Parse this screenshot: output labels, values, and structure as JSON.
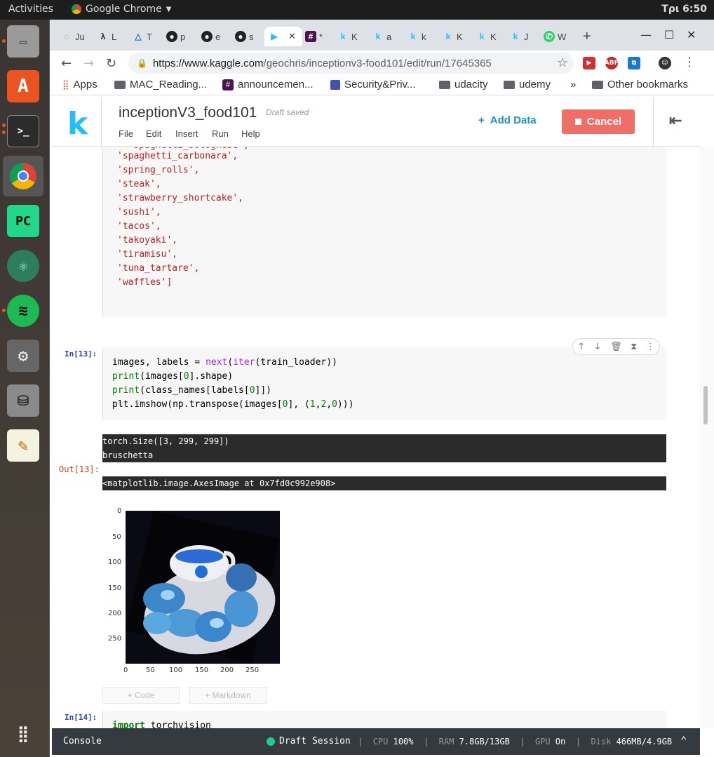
{
  "os": {
    "activities": "Activities",
    "app_name": "Google Chrome",
    "clock": "Τρι 6:50"
  },
  "tabs": [
    {
      "label": "Ju",
      "icon": "jupyter-icon"
    },
    {
      "label": "L",
      "icon": "lambda-icon"
    },
    {
      "label": "T",
      "icon": "triangle-icon"
    },
    {
      "label": "p",
      "icon": "github-icon"
    },
    {
      "label": "e",
      "icon": "github-icon"
    },
    {
      "label": "s",
      "icon": "github-icon"
    },
    {
      "label": "",
      "icon": "play-icon",
      "active": true
    },
    {
      "label": "*",
      "icon": "slack-icon"
    },
    {
      "label": "K",
      "icon": "kaggle-icon"
    },
    {
      "label": "a",
      "icon": "kaggle-icon"
    },
    {
      "label": "k",
      "icon": "kaggle-icon"
    },
    {
      "label": "K",
      "icon": "kaggle-icon"
    },
    {
      "label": "K",
      "icon": "kaggle-icon"
    },
    {
      "label": "J",
      "icon": "kaggle-icon"
    },
    {
      "label": "W",
      "icon": "whatsapp-icon"
    }
  ],
  "address": {
    "host": "https://www.kaggle.com",
    "path": "/geochris/inceptionv3-food101/edit/run/17645365"
  },
  "bookmarks": {
    "apps": "Apps",
    "b1": "MAC_Reading...",
    "b2": "announcemen...",
    "b3": "Security&Priv...",
    "b4": "udacity",
    "b5": "udemy",
    "more": "»",
    "other": "Other bookmarks"
  },
  "kaggle": {
    "logo": "k",
    "title": "inceptionV3_food101",
    "draft": "Draft saved",
    "menu": [
      "File",
      "Edit",
      "Insert",
      "Run",
      "Help"
    ],
    "add_data": "Add Data",
    "cancel": "Cancel"
  },
  "cell_prev": {
    "lines": [
      "'spaghetti_carbonara',",
      "'spring_rolls',",
      "'steak',",
      "'strawberry_shortcake',",
      "'sushi',",
      "'tacos',",
      "'takoyaki',",
      "'tiramisu',",
      "'tuna_tartare',",
      "'waffles']"
    ]
  },
  "cell13": {
    "prompt": "In[13]:",
    "out_prompt": "Out[13]:",
    "line1": "images, labels = ",
    "line1b": "next",
    "line1c": "(",
    "line1d": "iter",
    "line1e": "(train_loader))",
    "l2a": "print",
    "l2b": "(images[",
    "l2c": "0",
    "l2d": "].shape)",
    "l3a": "print",
    "l3b": "(class_names[labels[",
    "l3c": "0",
    "l3d": "]])",
    "l4a": "plt.imshow(np.transpose(images[",
    "l4b": "0",
    "l4c": "], (",
    "l4d": "1",
    "l4e": ",",
    "l4f": "2",
    "l4g": ",",
    "l4h": "0",
    "l4i": ")))",
    "stdout1": "torch.Size([3, 299, 299])",
    "stdout2": "bruschetta",
    "result": "<matplotlib.image.AxesImage at 0x7fd0c992e908>"
  },
  "plot": {
    "yticks": [
      "0",
      "50",
      "100",
      "150",
      "200",
      "250"
    ],
    "xticks": [
      "0",
      "50",
      "100",
      "150",
      "200",
      "250"
    ]
  },
  "add_buttons": {
    "code": "+ Code",
    "markdown": "+ Markdown"
  },
  "cell14": {
    "prompt": "In[14]:",
    "kw": "import",
    "rest": " torchvision"
  },
  "status": {
    "console": "Console",
    "session": "Draft Session",
    "cpu_label": "CPU",
    "cpu": "100%",
    "ram_label": "RAM",
    "ram": "7.8GB/13GB",
    "gpu_label": "GPU",
    "gpu": "On",
    "disk_label": "Disk",
    "disk": "466MB/4.9GB"
  },
  "colors": {
    "kaggle_blue": "#20beff",
    "cancel_red": "#f06d68",
    "status_bg": "#343a40",
    "session_green": "#20c997"
  }
}
